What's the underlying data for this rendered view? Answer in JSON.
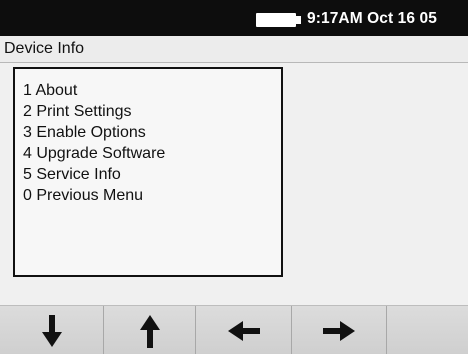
{
  "status_bar": {
    "time_date": "9:17AM Oct 16 05",
    "battery_icon": "battery-icon"
  },
  "title_bar": {
    "title": "Device Info"
  },
  "menu": {
    "items": [
      {
        "label": "1 About"
      },
      {
        "label": "2 Print Settings"
      },
      {
        "label": "3 Enable Options"
      },
      {
        "label": "4 Upgrade Software"
      },
      {
        "label": "5 Service Info"
      },
      {
        "label": "0 Previous Menu"
      }
    ]
  },
  "softkeys": [
    {
      "icon": "arrow-down-icon"
    },
    {
      "icon": "arrow-up-icon"
    },
    {
      "icon": "arrow-left-icon"
    },
    {
      "icon": "arrow-right-icon"
    },
    {
      "icon": ""
    }
  ],
  "colors": {
    "status_bar": "#0d0d0d",
    "background": "#f0f0f0",
    "text": "#111111",
    "softkey": "#d6d6d6"
  }
}
